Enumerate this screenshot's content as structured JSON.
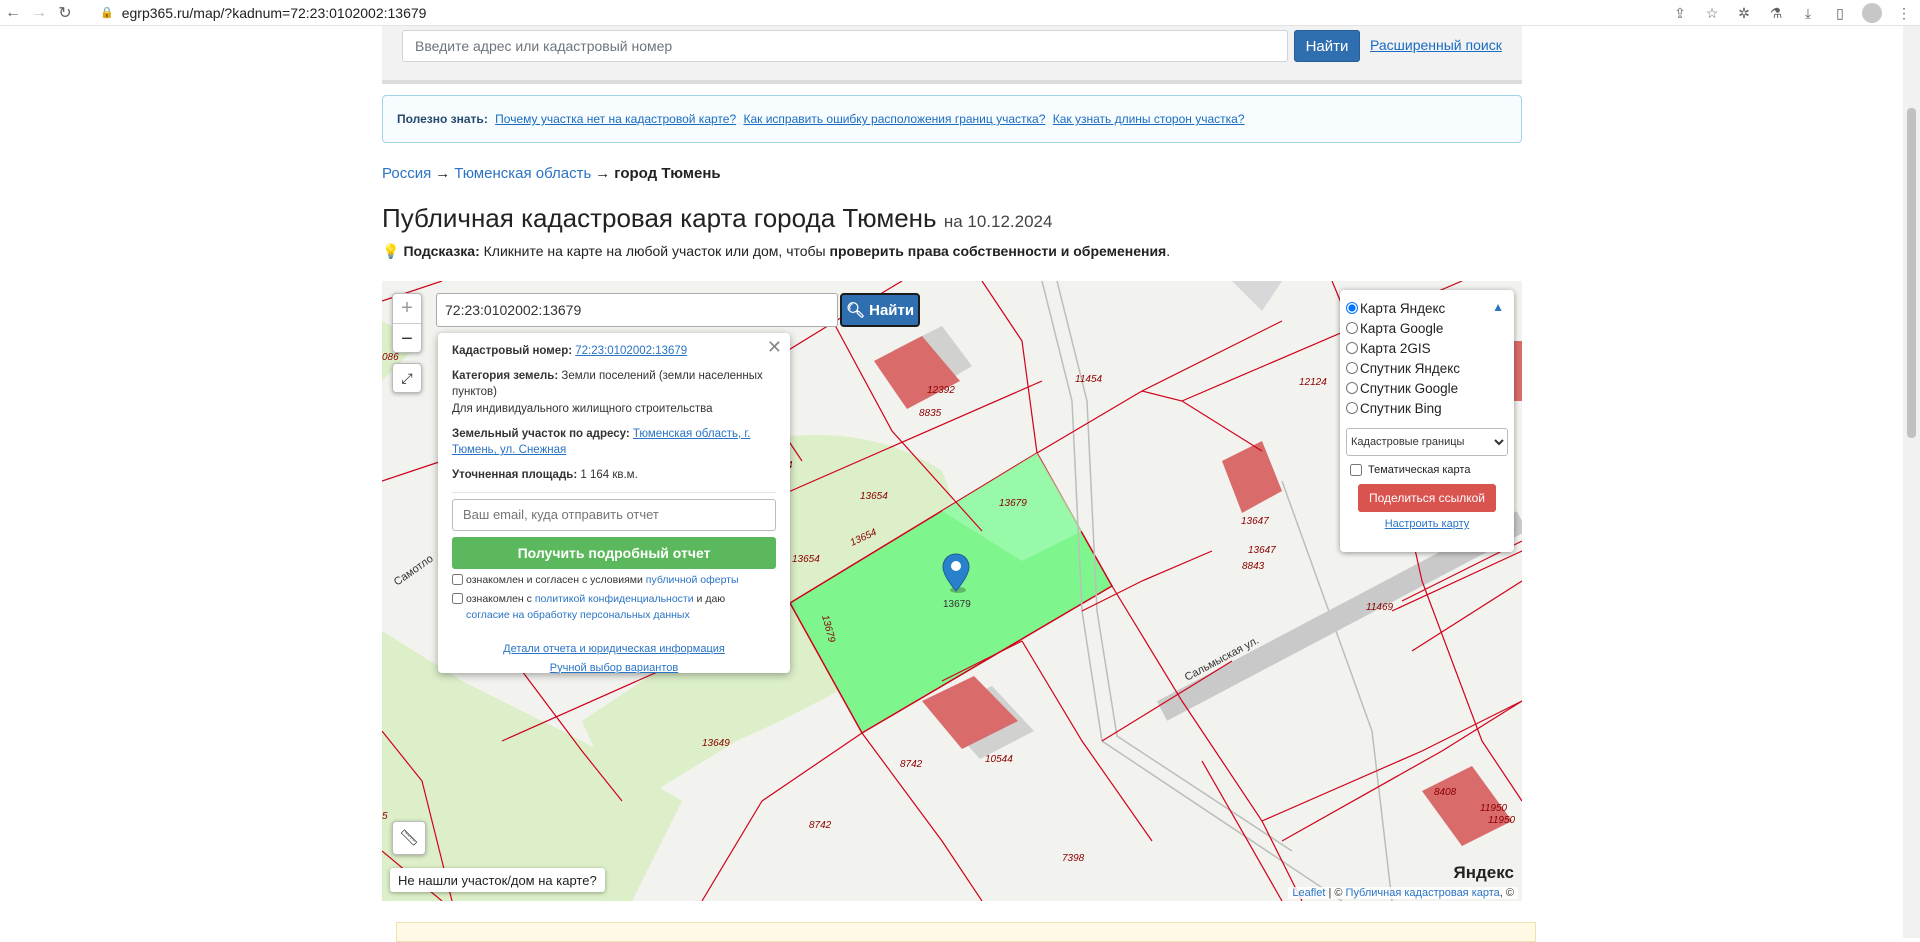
{
  "browser": {
    "url": "egrp365.ru/map/?kadnum=72:23:0102002:13679"
  },
  "top_search": {
    "placeholder": "Введите адрес или кадастровый номер",
    "button": "Найти",
    "advanced_link": "Расширенный поиск"
  },
  "info": {
    "label": "Полезно знать:",
    "links": [
      "Почему участка нет на кадастровой карте?",
      "Как исправить ошибку расположения границ участка?",
      "Как узнать длины сторон участка?"
    ]
  },
  "breadcrumb": {
    "items": [
      "Россия",
      "Тюменская область"
    ],
    "current": "город Тюмень",
    "separator": "→"
  },
  "page": {
    "title": "Публичная кадастровая карта города Тюмень",
    "date": "на 10.12.2024"
  },
  "hint": {
    "label": "Подсказка:",
    "text": "Кликните на карте на любой участок или дом, чтобы",
    "bold": "проверить права собственности и обременения",
    "end": "."
  },
  "map": {
    "search_value": "72:23:0102002:13679",
    "find_button": "Найти",
    "zoom_in": "+",
    "zoom_out": "−",
    "not_found": "Не нашли участок/дом на карте?",
    "logo": "Яндекс",
    "attribution": {
      "leaflet": "Leaflet",
      "sep": "| ©",
      "cadastral": "Публичная кадастровая карта",
      "end": ", ©"
    },
    "marker_label": "13679",
    "parcel_labels": [
      "12392",
      "8835",
      "11454",
      "12124",
      "13654",
      "13679",
      "13654",
      "13654",
      "13679",
      "13647",
      "13647",
      "8843",
      "11469",
      "Сальмыская ул.",
      "Самотло",
      "13649",
      "8742",
      "10544",
      "8742",
      "7398",
      "8408",
      "11950",
      "11950",
      "086",
      "4",
      "5"
    ]
  },
  "popup": {
    "cad_label": "Кадастровый номер:",
    "cad_value": "72:23:0102002:13679",
    "cat_label": "Категория земель:",
    "cat_value": "Земли поселений (земли населенных пунктов)",
    "use_value": "Для индивидуального жилищного строительства",
    "addr_label": "Земельный участок по адресу:",
    "addr_value": "Тюменская область, г. Тюмень, ул. Снежная",
    "area_label": "Уточненная площадь:",
    "area_value": "1 164 кв.м.",
    "email_placeholder": "Ваш email, куда отправить отчет",
    "report_button": "Получить подробный отчет",
    "agree1_text": "ознакомлен и согласен с условиями",
    "agree1_link": "публичной оферты",
    "agree2_text": "ознакомлен с",
    "agree2_link": "политикой конфиденциальности",
    "agree2_mid": "и даю",
    "agree2_link2": "согласие на обработку персональных данных",
    "details_link": "Детали отчета и юридическая информация",
    "manual_link": "Ручной выбор вариантов"
  },
  "layers": {
    "options": [
      "Карта Яндекс",
      "Карта Google",
      "Карта 2GIS",
      "Спутник Яндекс",
      "Спутник Google",
      "Спутник Bing"
    ],
    "selected": "Карта Яндекс",
    "select_value": "Кадастровые границы",
    "thematic": "Тематическая карта",
    "share_button": "Поделиться ссылкой",
    "configure_link": "Настроить карту"
  },
  "colors": {
    "accent": "#2f6fb0",
    "parcel_selected": "#7ff58e",
    "boundary": "#d0021b",
    "building": "#d96b6b",
    "report_green": "#5cb85c",
    "share_red": "#d9534f"
  }
}
